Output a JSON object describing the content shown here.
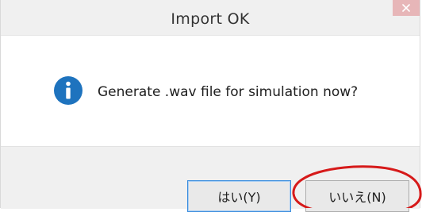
{
  "dialog": {
    "title": "Import OK",
    "message": "Generate .wav file for simulation now?",
    "icon": "info-icon",
    "close_icon": "close-icon"
  },
  "buttons": {
    "yes_label": "はい(Y)",
    "no_label": "いいえ(N)"
  },
  "colors": {
    "info_icon": "#1e73be",
    "close_button": "#e7b6b8",
    "annotation_circle": "#d61a1a"
  }
}
